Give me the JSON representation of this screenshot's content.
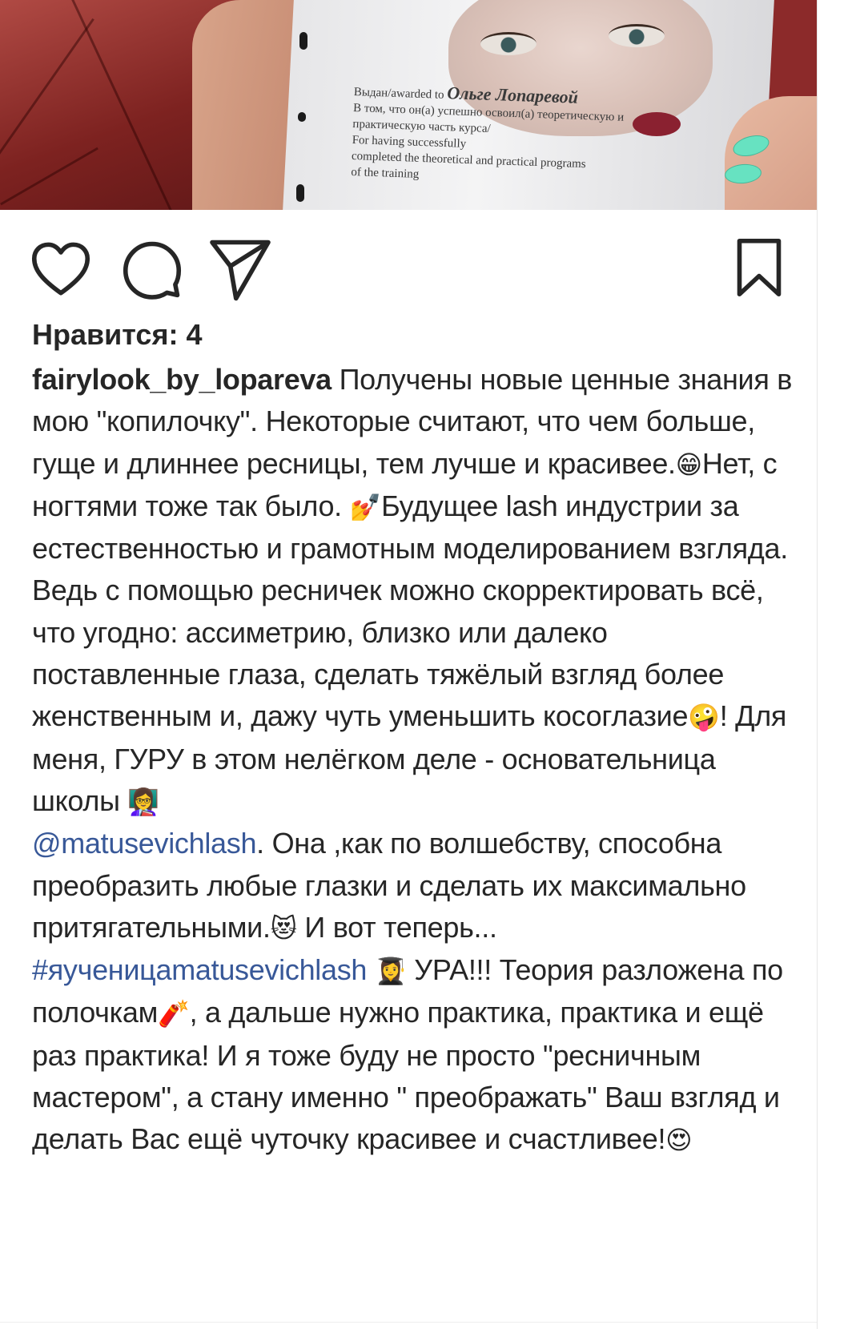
{
  "post": {
    "image": {
      "certificate_awarded_to": "Выдан/awarded to",
      "certificate_name": "Ольге Лопаревой",
      "certificate_line_1": "В том, что он(а) успешно освоил(а) теоретическую и",
      "certificate_line_2": "практическую часть курса/",
      "certificate_line_3": "For having successfully",
      "certificate_line_4": "completed the theoretical and practical programs",
      "certificate_line_5": "of the training"
    },
    "actions": {
      "like_icon": "heart-icon",
      "comment_icon": "comment-icon",
      "share_icon": "send-icon",
      "save_icon": "bookmark-icon"
    },
    "likes_label": "Нравится: 4",
    "caption": {
      "username": "fairylook_by_lopareva",
      "text_1": " Получены новые ценные знания в мою \"копилочку\". Некоторые считают, что чем больше, гуще и длиннее ресницы, тем лучше и красивее.",
      "emoji_1": "😁",
      "text_2": "Нет, с ногтями тоже так было. ",
      "emoji_2": "💅",
      "text_3": "Будущее lash индустрии за естественностью и грамотным моделированием взгляда. Ведь с помощью ресничек можно скорректировать всё, что угодно: ассиметрию, близко или далеко поставленные глаза, сделать тяжёлый взгляд более женственным и, дажу чуть уменьшить косоглазие",
      "emoji_3": "🤪",
      "text_4": "! Для меня, ГУРУ в этом нелёгком деле - основательница школы ",
      "emoji_4": "👩‍🏫",
      "mention": "@matusevichlash",
      "text_5": ". Она ,как по волшебству, способна преобразить любые глазки и сделать их максимально притягательными.",
      "emoji_5": "😻",
      "text_6": " И вот теперь... ",
      "hashtag": "#яученицаmatusevichlash",
      "emoji_6": " 👩‍🎓",
      "text_7": "УРА!!! Теория разложена по полочкам",
      "emoji_7": "🧨",
      "text_8": ", а дальше нужно практика, практика и ещё раз практика! И я тоже буду не просто \"ресничным мастером\", а стану именно \" преображать\" Ваш взгляд и делать Вас ещё чуточку красивее и счастливее!",
      "emoji_8": "😍"
    },
    "colors": {
      "text": "#262626",
      "link": "#385898",
      "nail_polish": "#67e2c1"
    }
  }
}
